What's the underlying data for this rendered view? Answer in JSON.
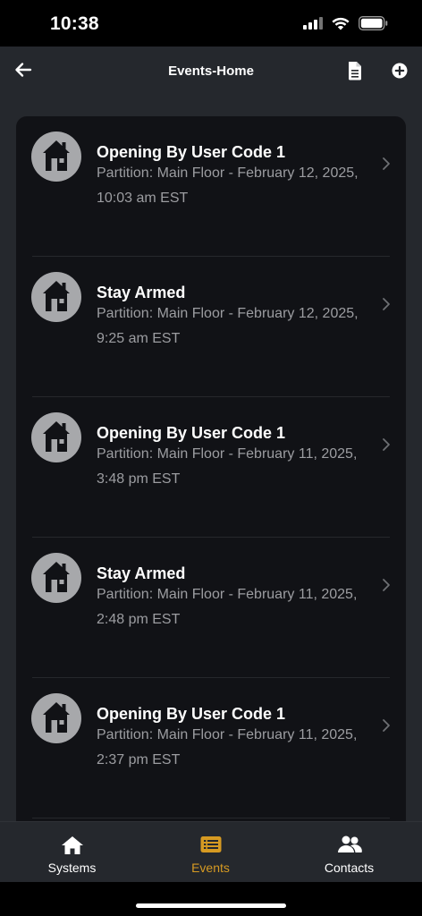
{
  "status_bar": {
    "time": "10:38"
  },
  "header": {
    "title": "Events-Home"
  },
  "events": [
    {
      "title": "Opening By User Code 1",
      "detail": "Partition: Main Floor - February 12, 2025, 10:03 am EST"
    },
    {
      "title": "Stay Armed",
      "detail": "Partition: Main Floor - February 12, 2025, 9:25 am EST"
    },
    {
      "title": "Opening By User Code 1",
      "detail": "Partition: Main Floor - February 11, 2025, 3:48 pm EST"
    },
    {
      "title": "Stay Armed",
      "detail": "Partition: Main Floor - February 11, 2025, 2:48 pm EST"
    },
    {
      "title": "Opening By User Code 1",
      "detail": "Partition: Main Floor - February 11, 2025, 2:37 pm EST"
    }
  ],
  "tabs": [
    {
      "label": "Systems",
      "icon": "home-icon",
      "active": false
    },
    {
      "label": "Events",
      "icon": "events-list-icon",
      "active": true
    },
    {
      "label": "Contacts",
      "icon": "contacts-icon",
      "active": false
    }
  ],
  "colors": {
    "background": "#25282d",
    "card": "#111216",
    "accent": "#d69a22",
    "avatar": "#a7a8ab",
    "secondary_text": "#9c9da1"
  }
}
